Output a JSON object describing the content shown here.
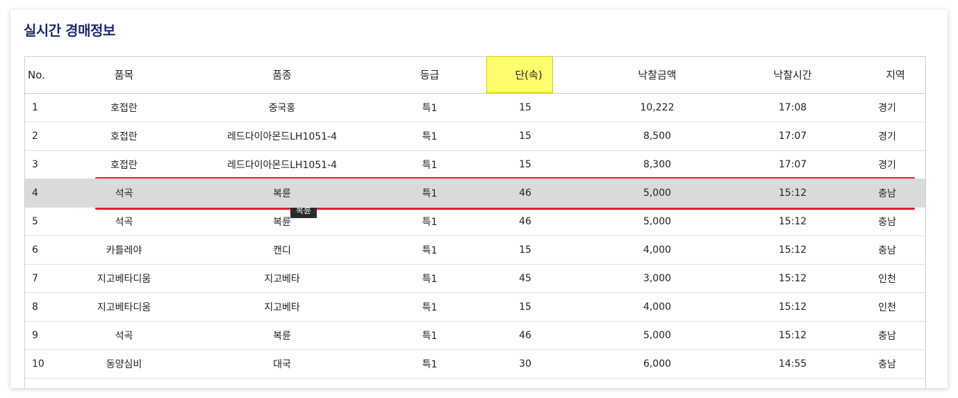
{
  "panel": {
    "title": "실시간 경매정보"
  },
  "table": {
    "headers": {
      "no": "No.",
      "item": "품목",
      "variety": "품종",
      "grade": "등급",
      "unit": "단(속)",
      "price": "낙찰금액",
      "time": "낙찰시간",
      "region": "지역"
    },
    "highlighted_header": "unit",
    "selected_row_index": 3,
    "rows": [
      {
        "no": "1",
        "item": "호접란",
        "variety": "중국홍",
        "grade": "특1",
        "unit": "15",
        "price": "10,222",
        "time": "17:08",
        "region": "경기"
      },
      {
        "no": "2",
        "item": "호접란",
        "variety": "레드다이아몬드LH1051-4",
        "grade": "특1",
        "unit": "15",
        "price": "8,500",
        "time": "17:07",
        "region": "경기"
      },
      {
        "no": "3",
        "item": "호접란",
        "variety": "레드다이아몬드LH1051-4",
        "grade": "특1",
        "unit": "15",
        "price": "8,300",
        "time": "17:07",
        "region": "경기"
      },
      {
        "no": "4",
        "item": "석곡",
        "variety": "복륜",
        "grade": "특1",
        "unit": "46",
        "price": "5,000",
        "time": "15:12",
        "region": "충남"
      },
      {
        "no": "5",
        "item": "석곡",
        "variety": "복륜",
        "grade": "특1",
        "unit": "46",
        "price": "5,000",
        "time": "15:12",
        "region": "충남"
      },
      {
        "no": "6",
        "item": "카틀레야",
        "variety": "캔디",
        "grade": "특1",
        "unit": "15",
        "price": "4,000",
        "time": "15:12",
        "region": "충남"
      },
      {
        "no": "7",
        "item": "지고베타디움",
        "variety": "지고베타",
        "grade": "특1",
        "unit": "45",
        "price": "3,000",
        "time": "15:12",
        "region": "인천"
      },
      {
        "no": "8",
        "item": "지고베타디움",
        "variety": "지고베타",
        "grade": "특1",
        "unit": "15",
        "price": "4,000",
        "time": "15:12",
        "region": "인천"
      },
      {
        "no": "9",
        "item": "석곡",
        "variety": "복륜",
        "grade": "특1",
        "unit": "46",
        "price": "5,000",
        "time": "15:12",
        "region": "충남"
      },
      {
        "no": "10",
        "item": "동양심비",
        "variety": "대국",
        "grade": "특1",
        "unit": "30",
        "price": "6,000",
        "time": "14:55",
        "region": "충남"
      }
    ]
  },
  "tooltip": {
    "text": "복륜"
  },
  "colors": {
    "title": "#1a2a6c",
    "header_highlight": "#fdfd6e",
    "selection_frame": "#e0202e",
    "selected_row": "#dadada"
  }
}
